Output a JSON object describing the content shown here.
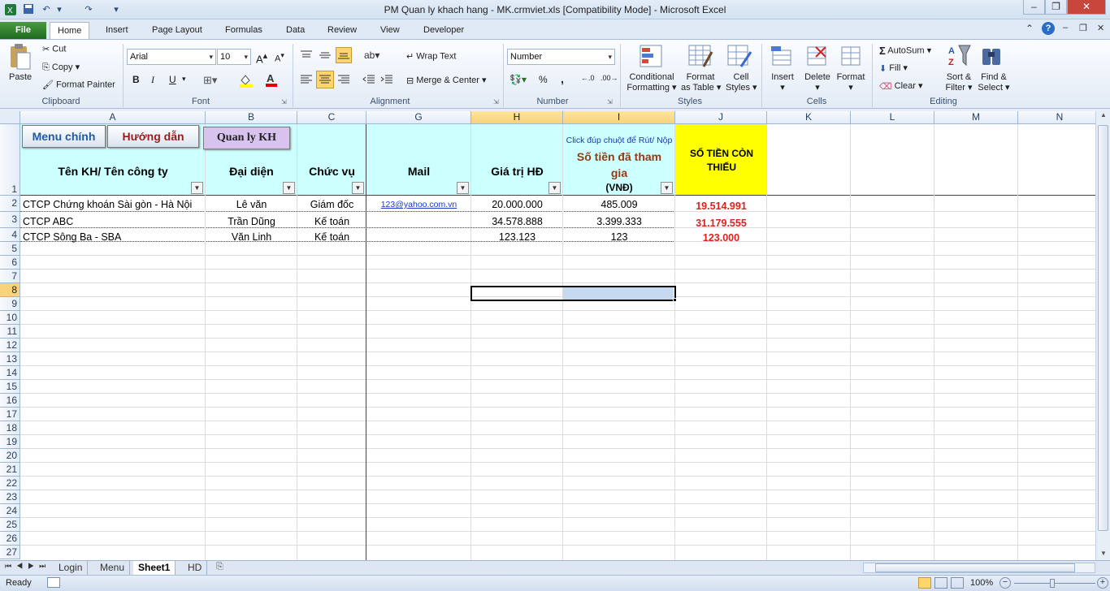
{
  "window": {
    "title": "PM Quan ly khach hang - MK.crmviet.xls  [Compatibility Mode]  -  Microsoft Excel",
    "controls": [
      "–",
      "❐",
      "✕"
    ]
  },
  "ribbon_tabs": [
    "File",
    "Home",
    "Insert",
    "Page Layout",
    "Formulas",
    "Data",
    "Review",
    "View",
    "Developer"
  ],
  "ribbon": {
    "clipboard": {
      "paste": "Paste",
      "cut": "Cut",
      "copy": "Copy",
      "format_painter": "Format Painter",
      "label": "Clipboard"
    },
    "font": {
      "name": "Arial",
      "size": "10",
      "bold": "B",
      "italic": "I",
      "underline": "U",
      "label": "Font"
    },
    "alignment": {
      "wrap_text": "Wrap Text",
      "merge_center": "Merge & Center",
      "label": "Alignment"
    },
    "number": {
      "format": "Number",
      "percent": "%",
      "comma": ",",
      "label": "Number"
    },
    "styles": {
      "conditional": "Conditional",
      "conditional2": "Formatting",
      "format_as": "Format",
      "format_as2": "as Table",
      "cell": "Cell",
      "cell2": "Styles",
      "label": "Styles"
    },
    "cells": {
      "insert": "Insert",
      "delete": "Delete",
      "format": "Format",
      "label": "Cells"
    },
    "editing": {
      "autosum": "AutoSum",
      "fill": "Fill",
      "clear": "Clear",
      "sort": "Sort &",
      "sort2": "Filter",
      "find": "Find &",
      "find2": "Select",
      "label": "Editing"
    }
  },
  "columns": [
    "A",
    "B",
    "C",
    "G",
    "H",
    "I",
    "J",
    "K",
    "L",
    "M",
    "N"
  ],
  "rows": [
    "1",
    "2",
    "3",
    "4",
    "5",
    "6",
    "7",
    "8",
    "9",
    "10",
    "11",
    "12",
    "13",
    "14",
    "15",
    "16",
    "17",
    "18",
    "19",
    "20",
    "21",
    "22",
    "23",
    "24",
    "25",
    "26",
    "27"
  ],
  "buttons": {
    "menu": "Menu chính",
    "guide": "Hướng dẫn",
    "manage": "Quan ly KH"
  },
  "headers": {
    "company": "Tên KH/ Tên công ty",
    "rep": "Đại diện",
    "position": "Chức vụ",
    "mail": "Mail",
    "contract": "Giá trị HĐ",
    "hint": "Click đúp chuột để Rút/ Nộp",
    "paid": "Số tiền đã tham gia",
    "paid_unit": "(VNĐ)",
    "remaining": "SỐ TIỀN CÒN THIẾU"
  },
  "table_rows": [
    {
      "company": "CTCP Chứng khoán Sài gòn - Hà Nội",
      "rep": "Lê văn",
      "position": "Giám đốc",
      "mail": "123@yahoo.com.vn",
      "contract": "20.000.000",
      "paid": "485.009",
      "remaining": "19.514.991"
    },
    {
      "company": "CTCP ABC",
      "rep": "Trần Dũng",
      "position": "Kế toán",
      "mail": "",
      "contract": "34.578.888",
      "paid": "3.399.333",
      "remaining": "31.179.555"
    },
    {
      "company": "CTCP Sông Ba - SBA",
      "rep": "Văn Linh",
      "position": "Kế toán",
      "mail": "",
      "contract": "123.123",
      "paid": "123",
      "remaining": "123.000"
    }
  ],
  "sheets": [
    "Login",
    "Menu",
    "Sheet1",
    "HD"
  ],
  "status": {
    "ready": "Ready",
    "zoom": "100%"
  },
  "colors": {
    "header_fill": "#ccffff",
    "remaining_fill": "#ffff00",
    "remaining_text": "#e0201f",
    "paid_header_text": "#953a0f"
  }
}
